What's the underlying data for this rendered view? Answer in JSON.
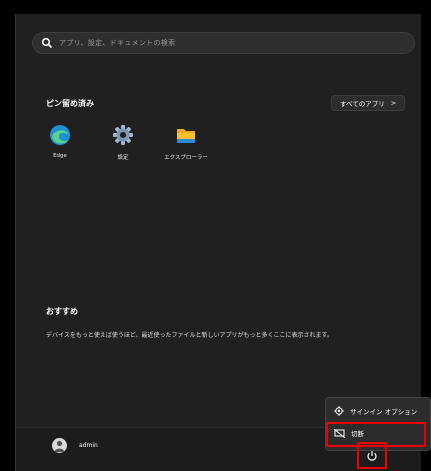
{
  "search": {
    "placeholder": "アプリ、設定、ドキュメントの検索"
  },
  "pinned": {
    "title": "ピン留め済み",
    "all_apps_label": "すべてのアプリ",
    "all_apps_chevron": ">",
    "apps": [
      {
        "label": "Edge",
        "icon": "edge-icon"
      },
      {
        "label": "設定",
        "icon": "settings-icon"
      },
      {
        "label": "エクスプローラー",
        "icon": "folder-icon"
      }
    ]
  },
  "recommended": {
    "title": "おすすめ",
    "text": "デバイスをもっと使えば使うほど、最近使ったファイルと新しいアプリがもっと多くここに表示されます。"
  },
  "user": {
    "name": "admin"
  },
  "power_menu": {
    "items": [
      {
        "label": "サインイン オプション",
        "icon": "gear-icon"
      },
      {
        "label": "切断",
        "icon": "disconnect-icon"
      }
    ]
  },
  "colors": {
    "highlight": "#e00000",
    "menu_bg": "#202020",
    "accent_edge": "#1e90d6",
    "folder": "#f5c02b"
  }
}
